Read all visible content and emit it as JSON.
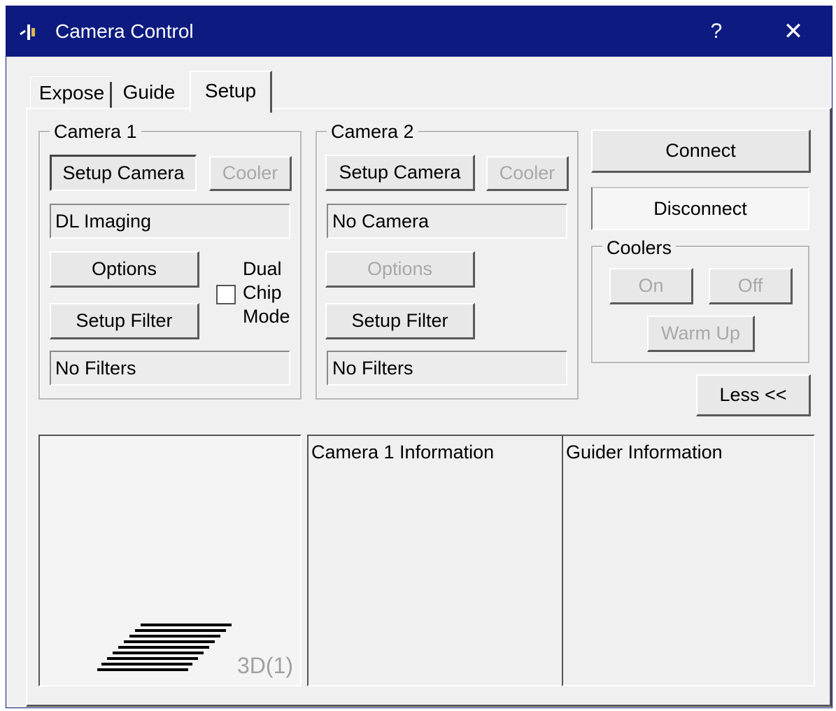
{
  "window": {
    "title": "Camera Control",
    "help_glyph": "?",
    "close_glyph": "✕",
    "title_color": "#0d1b80"
  },
  "tabs": [
    {
      "label": "Expose",
      "active": false
    },
    {
      "label": "Guide",
      "active": false
    },
    {
      "label": "Setup",
      "active": true
    }
  ],
  "camera1": {
    "legend": "Camera 1",
    "setup_camera_label": "Setup Camera",
    "cooler_label": "Cooler",
    "camera_name": "DL Imaging",
    "options_label": "Options",
    "dual_chip_line1": "Dual",
    "dual_chip_line2": "Chip",
    "dual_chip_line3": "Mode",
    "dual_chip_checked": false,
    "setup_filter_label": "Setup Filter",
    "filters": "No Filters"
  },
  "camera2": {
    "legend": "Camera 2",
    "setup_camera_label": "Setup Camera",
    "cooler_label": "Cooler",
    "camera_name": "No Camera",
    "options_label": "Options",
    "setup_filter_label": "Setup Filter",
    "filters": "No Filters"
  },
  "right": {
    "connect_label": "Connect",
    "disconnect_label": "Disconnect",
    "coolers_legend": "Coolers",
    "on_label": "On",
    "off_label": "Off",
    "warm_up_label": "Warm Up",
    "less_label": "Less <<"
  },
  "bottom": {
    "preview_label": "3D(1)",
    "camera1_info_title": "Camera 1 Information",
    "guider_info_title": "Guider Information"
  }
}
